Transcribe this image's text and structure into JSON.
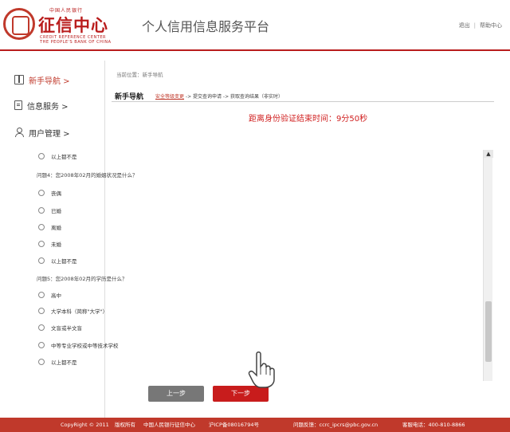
{
  "header": {
    "logo_small": "中国人民银行",
    "logo_main": "征信中心",
    "logo_en_line1": "CREDIT REFERENCE CENTER",
    "logo_en_line2": "THE PEOPLE'S BANK OF CHINA",
    "platform_title": "个人信用信息服务平台",
    "logout": "退出",
    "help": "帮助中心"
  },
  "sidebar": {
    "items": [
      {
        "label": "新手导航 >",
        "icon": "book-icon",
        "active": true
      },
      {
        "label": "信息服务 >",
        "icon": "document-icon",
        "active": false
      },
      {
        "label": "用户管理 >",
        "icon": "user-icon",
        "active": false
      }
    ]
  },
  "main": {
    "breadcrumb": "当前位置：新手导航",
    "steps_title": "新手导航",
    "step_current": "安全等级变更",
    "step_rest": " -> 提交查询申请 -> 获取查询结果（非实时）",
    "countdown": "距离身份验证结束时间：9分50秒",
    "top_option": "以上都不是",
    "q4": {
      "text": "问题4：您2008年02月的婚姻状况是什么？",
      "options": [
        "丧偶",
        "已婚",
        "离婚",
        "未婚",
        "以上都不是"
      ]
    },
    "q5": {
      "text": "问题5：您2008年02月的学历是什么？",
      "options": [
        "高中",
        "大学本科（简称\"大学\"）",
        "文盲或半文盲",
        "中等专业学校或中等技术学校",
        "以上都不是"
      ]
    },
    "prev_label": "上一步",
    "next_label": "下一步"
  },
  "footer": {
    "copyright": "CopyRight © 2011",
    "rights": "版权所有",
    "org": "中国人民银行征信中心",
    "icp": "沪ICP备08016794号",
    "feedback": "问题反馈：ccrc_ipcrs@pbc.gov.cn",
    "phone": "客服电话：400-810-8866"
  },
  "colors": {
    "brand_red": "#c0392b",
    "accent_red": "#c81c1c"
  }
}
